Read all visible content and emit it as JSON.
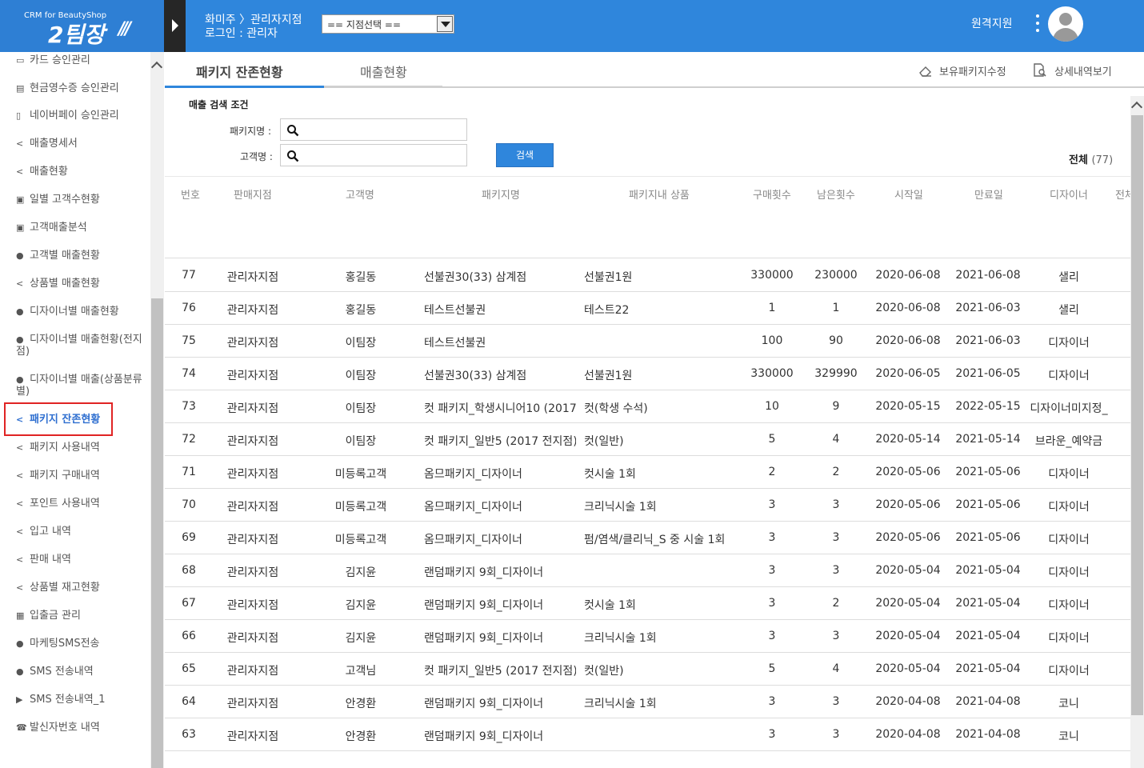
{
  "header": {
    "logo_sub": "CRM for BeautyShop",
    "logo_main": "2팀장",
    "logo_slash": "///",
    "shop": "화미주 〉관리자지점",
    "login": "로그인 : 관리자",
    "branch_select": "== 지점선택 ==",
    "remote": "원격지원"
  },
  "sidebar": {
    "items": [
      {
        "icon": "card-icon",
        "glyph": "▭",
        "label": "카드 승인관리"
      },
      {
        "icon": "cash-receipt-icon",
        "glyph": "▤",
        "label": "현금영수증 승인관리"
      },
      {
        "icon": "mobile-icon",
        "glyph": "▯",
        "label": "네이버페이 승인관리"
      },
      {
        "icon": "share-icon",
        "glyph": "<",
        "label": "매출명세서"
      },
      {
        "icon": "share-icon",
        "glyph": "<",
        "label": "매출현황"
      },
      {
        "icon": "id-card-icon",
        "glyph": "▣",
        "label": "일별 고객수현황"
      },
      {
        "icon": "id-card-icon",
        "glyph": "▣",
        "label": "고객매출분석"
      },
      {
        "icon": "user-icon",
        "glyph": "●",
        "label": "고객별 매출현황"
      },
      {
        "icon": "share-icon",
        "glyph": "<",
        "label": "상품별 매출현황"
      },
      {
        "icon": "user-icon",
        "glyph": "●",
        "label": "디자이너별 매출현황"
      },
      {
        "icon": "user-icon",
        "glyph": "●",
        "label": "디자이너별 매출현황(전지점)"
      },
      {
        "icon": "user-icon",
        "glyph": "●",
        "label": "디자이너별 매출(상품분류별)"
      },
      {
        "icon": "share-icon",
        "glyph": "<",
        "label": "패키지 잔존현황"
      },
      {
        "icon": "share-icon",
        "glyph": "<",
        "label": "패키지 사용내역"
      },
      {
        "icon": "share-icon",
        "glyph": "<",
        "label": "패키지 구매내역"
      },
      {
        "icon": "share-icon",
        "glyph": "<",
        "label": "포인트 사용내역"
      },
      {
        "icon": "share-icon",
        "glyph": "<",
        "label": "입고 내역"
      },
      {
        "icon": "share-icon",
        "glyph": "<",
        "label": "판매 내역"
      },
      {
        "icon": "share-icon",
        "glyph": "<",
        "label": "상품별 재고현황"
      },
      {
        "icon": "calculator-icon",
        "glyph": "▦",
        "label": "입출금 관리"
      },
      {
        "icon": "chat-icon",
        "glyph": "●",
        "label": "마케팅SMS전송"
      },
      {
        "icon": "chat-icon",
        "glyph": "●",
        "label": "SMS 전송내역"
      },
      {
        "icon": "flag-icon",
        "glyph": "▶",
        "label": "SMS 전송내역_1"
      },
      {
        "icon": "phone-icon",
        "glyph": "☎",
        "label": "발신자번호 내역"
      }
    ],
    "active_index": 12
  },
  "tabs": [
    {
      "label": "패키지 잔존현황",
      "active": true
    },
    {
      "label": "매출현황",
      "active": false
    }
  ],
  "actions": {
    "edit_package": "보유패키지수정",
    "view_detail": "상세내역보기"
  },
  "search": {
    "title": "매출 검색 조건",
    "package_label": "패키지명 :",
    "customer_label": "고객명 :",
    "button": "검색",
    "total_label": "전체",
    "total_count": "(77)"
  },
  "table": {
    "headers": [
      "번호",
      "판매지점",
      "고객명",
      "패키지명",
      "패키지내 상품",
      "구매횟수",
      "남은횟수",
      "시작일",
      "만료일",
      "디자이너",
      "전체"
    ],
    "rows": [
      [
        "77",
        "관리자지점",
        "홍길동",
        "선불권30(33) 삼계점",
        "선불권1원",
        "330000",
        "230000",
        "2020-06-08",
        "2021-06-08",
        "샐리"
      ],
      [
        "76",
        "관리자지점",
        "홍길동",
        "테스트선불권",
        "테스트22",
        "1",
        "1",
        "2020-06-08",
        "2021-06-03",
        "샐리"
      ],
      [
        "75",
        "관리자지점",
        "이팀장",
        "테스트선불권",
        "",
        "100",
        "90",
        "2020-06-08",
        "2021-06-03",
        "디자이너"
      ],
      [
        "74",
        "관리자지점",
        "이팀장",
        "선불권30(33) 삼계점",
        "선불권1원",
        "330000",
        "329990",
        "2020-06-05",
        "2021-06-05",
        "디자이너"
      ],
      [
        "73",
        "관리자지점",
        "이팀장",
        "컷 패키지_학생시니어10 (2017",
        "컷(학생 수석)",
        "10",
        "9",
        "2020-05-15",
        "2022-05-15",
        "디자이너미지정_"
      ],
      [
        "72",
        "관리자지점",
        "이팀장",
        "컷 패키지_일반5 (2017 전지점)",
        "컷(일반)",
        "5",
        "4",
        "2020-05-14",
        "2021-05-14",
        "브라운_예약금"
      ],
      [
        "71",
        "관리자지점",
        "미등록고객",
        "옴므패키지_디자이너",
        "컷시술 1회",
        "2",
        "2",
        "2020-05-06",
        "2021-05-06",
        "디자이너"
      ],
      [
        "70",
        "관리자지점",
        "미등록고객",
        "옴므패키지_디자이너",
        "크리닉시술 1회",
        "3",
        "3",
        "2020-05-06",
        "2021-05-06",
        "디자이너"
      ],
      [
        "69",
        "관리자지점",
        "미등록고객",
        "옴므패키지_디자이너",
        "펌/염색/클리닉_S 중 시술 1회",
        "3",
        "3",
        "2020-05-06",
        "2021-05-06",
        "디자이너"
      ],
      [
        "68",
        "관리자지점",
        "김지윤",
        "랜덤패키지 9회_디자이너",
        "",
        "3",
        "3",
        "2020-05-04",
        "2021-05-04",
        "디자이너"
      ],
      [
        "67",
        "관리자지점",
        "김지윤",
        "랜덤패키지 9회_디자이너",
        "컷시술 1회",
        "3",
        "2",
        "2020-05-04",
        "2021-05-04",
        "디자이너"
      ],
      [
        "66",
        "관리자지점",
        "김지윤",
        "랜덤패키지 9회_디자이너",
        "크리닉시술 1회",
        "3",
        "3",
        "2020-05-04",
        "2021-05-04",
        "디자이너"
      ],
      [
        "65",
        "관리자지점",
        "고객님",
        "컷 패키지_일반5 (2017 전지점)",
        "컷(일반)",
        "5",
        "4",
        "2020-05-04",
        "2021-05-04",
        "디자이너"
      ],
      [
        "64",
        "관리자지점",
        "안경환",
        "랜덤패키지 9회_디자이너",
        "크리닉시술 1회",
        "3",
        "3",
        "2020-04-08",
        "2021-04-08",
        "코니"
      ],
      [
        "63",
        "관리자지점",
        "안경환",
        "랜덤패키지 9회_디자이너",
        "",
        "3",
        "3",
        "2020-04-08",
        "2021-04-08",
        "코니"
      ]
    ]
  }
}
